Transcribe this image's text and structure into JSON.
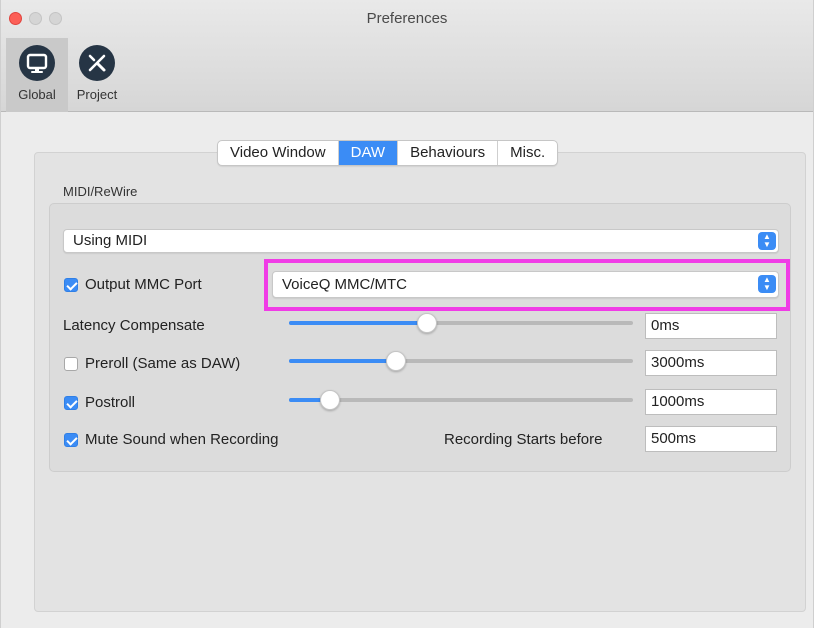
{
  "window": {
    "title": "Preferences"
  },
  "toolbar": {
    "items": [
      {
        "label": "Global",
        "icon": "monitor-icon",
        "selected": true
      },
      {
        "label": "Project",
        "icon": "tools-icon",
        "selected": false
      }
    ]
  },
  "tabs": [
    {
      "label": "Video Window",
      "active": false
    },
    {
      "label": "DAW",
      "active": true
    },
    {
      "label": "Behaviours",
      "active": false
    },
    {
      "label": "Misc.",
      "active": false
    }
  ],
  "midi": {
    "group_label": "MIDI/ReWire",
    "mode_select": {
      "value": "Using MIDI"
    },
    "output_mmc": {
      "label": "Output MMC Port",
      "checked": true
    },
    "port_select": {
      "value": "VoiceQ MMC/MTC"
    },
    "latency": {
      "label": "Latency Compensate",
      "slider_level": 0.4,
      "value": "0ms"
    },
    "preroll": {
      "label": "Preroll (Same as DAW)",
      "checked": false,
      "slider_level": 0.31,
      "value": "3000ms"
    },
    "postroll": {
      "label": "Postroll",
      "checked": true,
      "slider_level": 0.12,
      "value": "1000ms"
    },
    "mute": {
      "label": "Mute Sound when Recording",
      "checked": true
    },
    "recording_starts": {
      "label": "Recording Starts before",
      "value": "500ms"
    }
  },
  "colors": {
    "accent": "#3b8cf5",
    "highlight": "#f03ce6",
    "toolbar_icon": "#263545",
    "close_button": "#fc5f57"
  }
}
